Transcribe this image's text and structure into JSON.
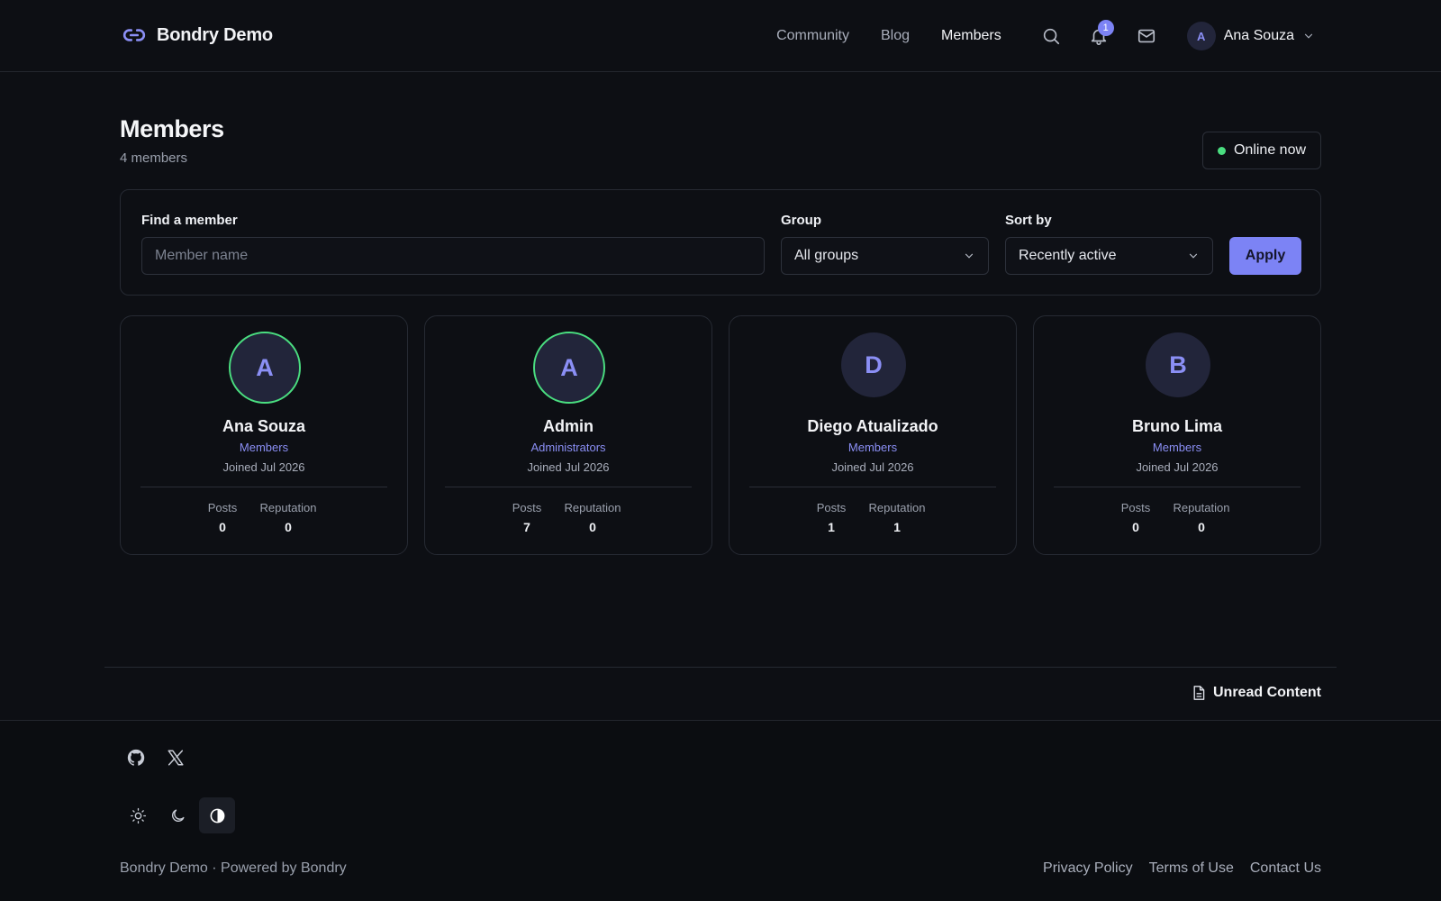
{
  "brand": {
    "name": "Bondry Demo",
    "icon": "link-icon"
  },
  "nav": {
    "items": [
      {
        "label": "Community",
        "active": false
      },
      {
        "label": "Blog",
        "active": false
      },
      {
        "label": "Members",
        "active": true
      }
    ],
    "notifications_count": "1",
    "user": {
      "initial": "A",
      "name": "Ana Souza"
    }
  },
  "page": {
    "title": "Members",
    "subtitle": "4 members",
    "online_button": "Online now"
  },
  "filters": {
    "search_label": "Find a member",
    "search_placeholder": "Member name",
    "search_value": "",
    "group_label": "Group",
    "group_value": "All groups",
    "sort_label": "Sort by",
    "sort_value": "Recently active",
    "apply_label": "Apply"
  },
  "stat_labels": {
    "posts": "Posts",
    "reputation": "Reputation"
  },
  "members": [
    {
      "initial": "A",
      "name": "Ana Souza",
      "group": "Members",
      "joined": "Joined Jul 2026",
      "posts": "0",
      "reputation": "0",
      "online": true
    },
    {
      "initial": "A",
      "name": "Admin",
      "group": "Administrators",
      "joined": "Joined Jul 2026",
      "posts": "7",
      "reputation": "0",
      "online": true
    },
    {
      "initial": "D",
      "name": "Diego Atualizado",
      "group": "Members",
      "joined": "Joined Jul 2026",
      "posts": "1",
      "reputation": "1",
      "online": false
    },
    {
      "initial": "B",
      "name": "Bruno Lima",
      "group": "Members",
      "joined": "Joined Jul 2026",
      "posts": "0",
      "reputation": "0",
      "online": false
    }
  ],
  "unread_link": "Unread Content",
  "footer": {
    "social": [
      "github-icon",
      "x-icon"
    ],
    "themes": [
      "sun-icon",
      "moon-icon",
      "contrast-icon"
    ],
    "active_theme": "contrast-icon",
    "copyright": "Bondry Demo · Powered by Bondry",
    "links": [
      "Privacy Policy",
      "Terms of Use",
      "Contact Us"
    ]
  },
  "colors": {
    "background": "#0d0f14",
    "accent": "#7c83f5",
    "online": "#4ade80"
  }
}
